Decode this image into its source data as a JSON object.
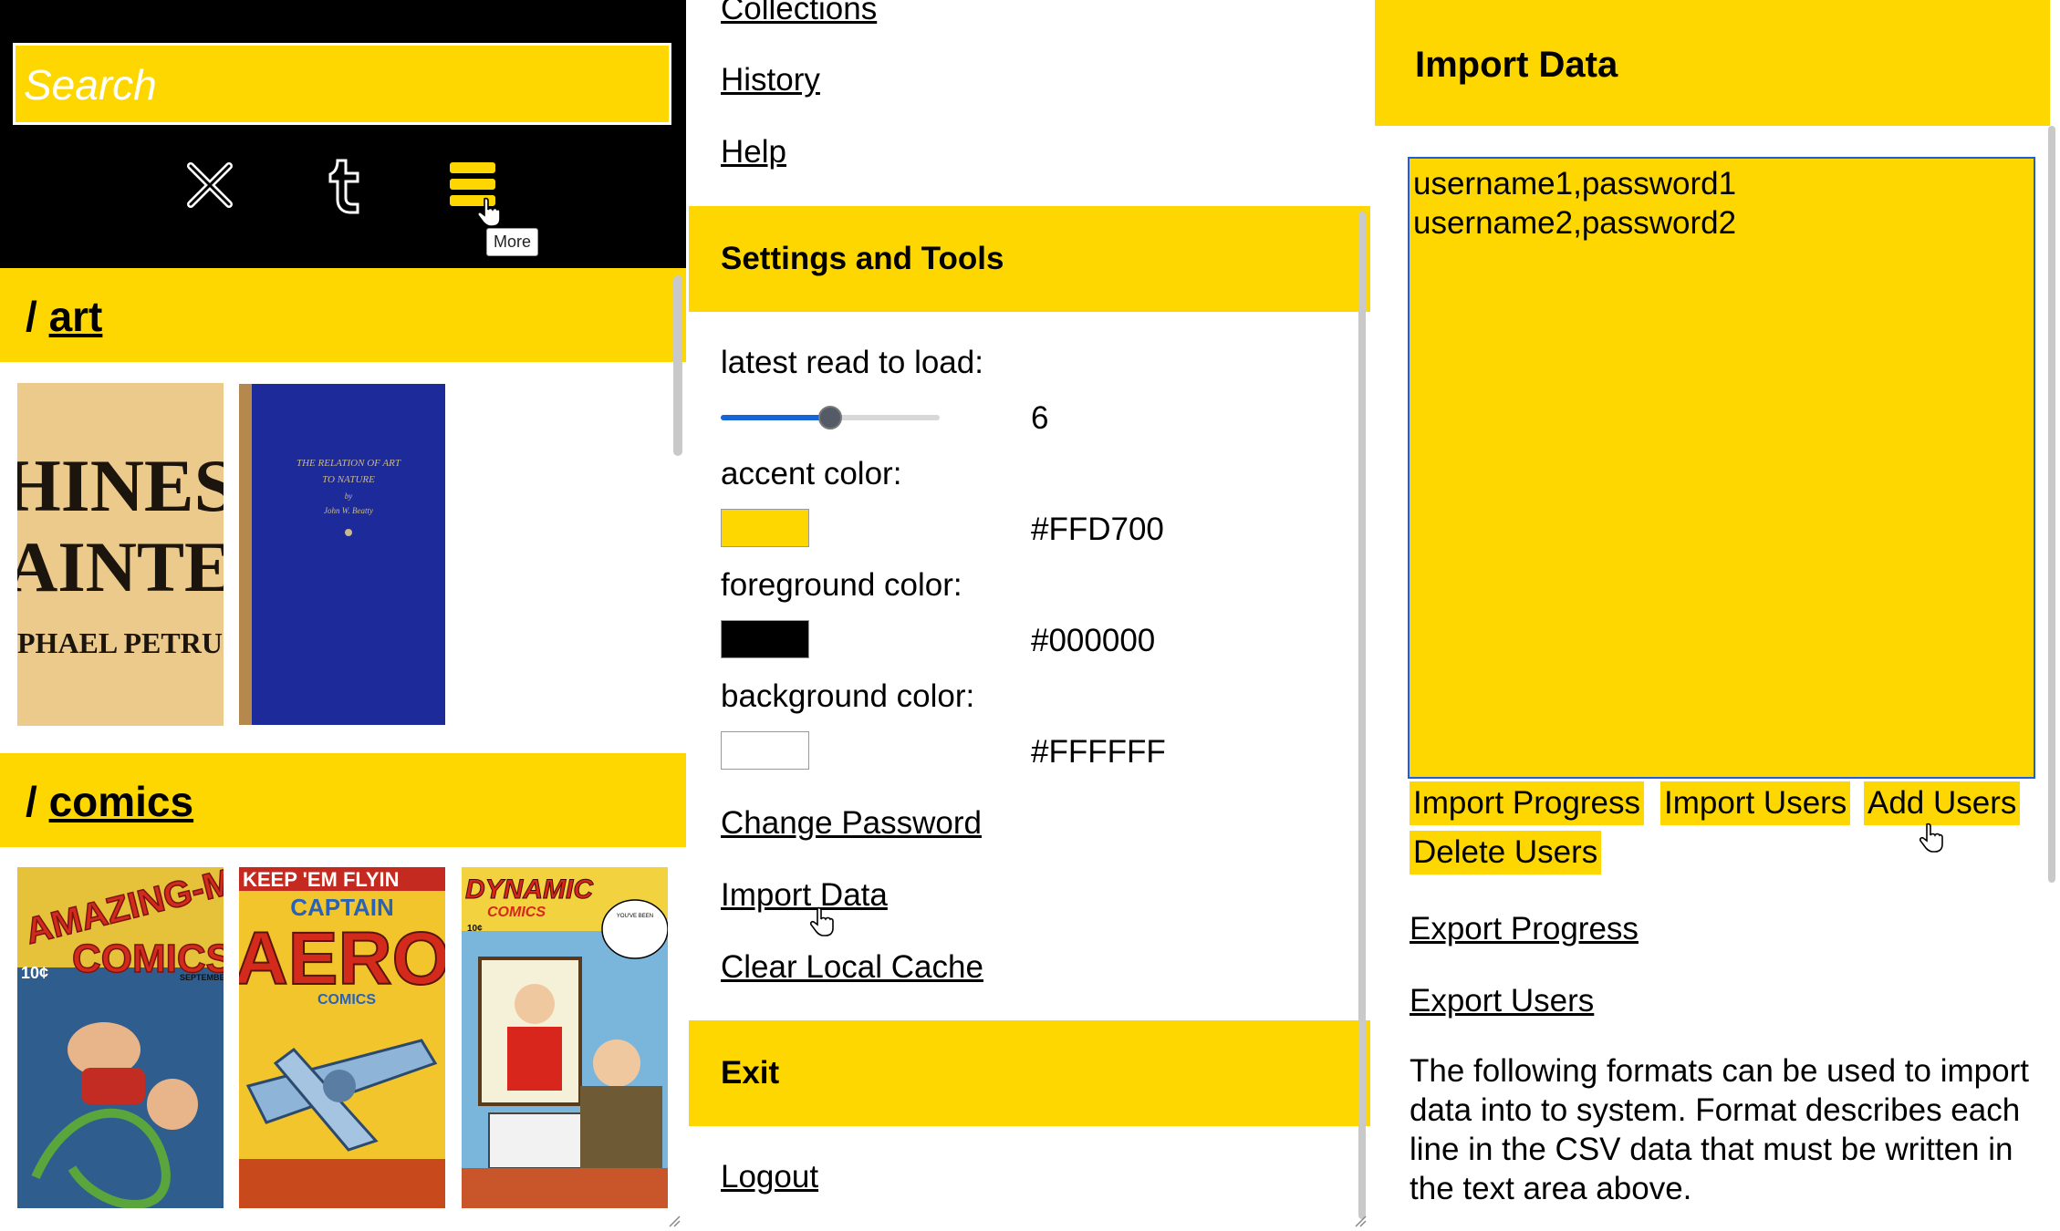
{
  "left": {
    "search_placeholder": "Search",
    "toolbar": {
      "close_icon": "close-icon",
      "tumblr_icon": "tumblr-icon",
      "menu_icon": "hamburger-menu-icon",
      "tooltip": "More"
    },
    "sections": [
      {
        "prefix": "/",
        "label": "art",
        "covers": [
          "HINES AINTER PHAEL PETRUC",
          "THE RELATION OF ART TO NATURE"
        ]
      },
      {
        "prefix": "/",
        "label": "comics",
        "covers": [
          "AMAZING-MAN COMICS",
          "KEEP 'EM FLYIN CAPTAIN AERO COMICS",
          "DYNAMIC COMICS"
        ]
      }
    ],
    "art_cover1": {
      "line1": "HINES",
      "line2": "AINTER",
      "line3": "PHAEL PETRUC"
    },
    "art_cover2": {
      "line1": "THE RELATION OF ART",
      "line2": "TO NATURE",
      "line3": "by",
      "line4": "John W. Beatty"
    },
    "comic_cover1": {
      "title": "AMAZING-MAN",
      "subtitle": "COMICS",
      "price": "10¢",
      "month": "SEPTEMBER"
    },
    "comic_cover2": {
      "banner": "KEEP 'EM FLYIN",
      "line1": "CAPTAIN",
      "line2": "AERO",
      "line3": "COMICS"
    },
    "comic_cover3": {
      "title": "DYNAMIC",
      "subtitle": "COMICS",
      "price": "10¢",
      "bubble": "YOU'VE BEEN DISCHARGED A WEEK NOW, DON'T YOU THINK IT'S TIME YOU WENT HOME?"
    }
  },
  "middle": {
    "links_top": [
      "Collections",
      "History",
      "Help"
    ],
    "settings_header": "Settings and Tools",
    "latest_read_label": "latest read to load:",
    "latest_read_value": "6",
    "latest_read_fraction": 0.5,
    "accent_label": "accent color:",
    "accent_value": "#FFD700",
    "foreground_label": "foreground color:",
    "foreground_value": "#000000",
    "background_label": "background color:",
    "background_value": "#FFFFFF",
    "change_password": "Change Password",
    "import_data": "Import Data",
    "clear_cache": "Clear Local Cache",
    "exit_header": "Exit",
    "logout": "Logout"
  },
  "right": {
    "header": "Import Data",
    "textarea_value": "username1,password1\nusername2,password2",
    "buttons": {
      "import_progress": "Import Progress",
      "import_users": "Import Users",
      "add_users": "Add Users",
      "delete_users": "Delete Users"
    },
    "export_progress": "Export Progress",
    "export_users": "Export Users",
    "description": "The following formats can be used to import data into to system. Format describes each line in the CSV data that must be written in the text area above."
  },
  "colors": {
    "accent": "#FFD700",
    "foreground": "#000000",
    "background": "#FFFFFF",
    "focus": "#1e5fd9",
    "slider": "#1565d8"
  }
}
